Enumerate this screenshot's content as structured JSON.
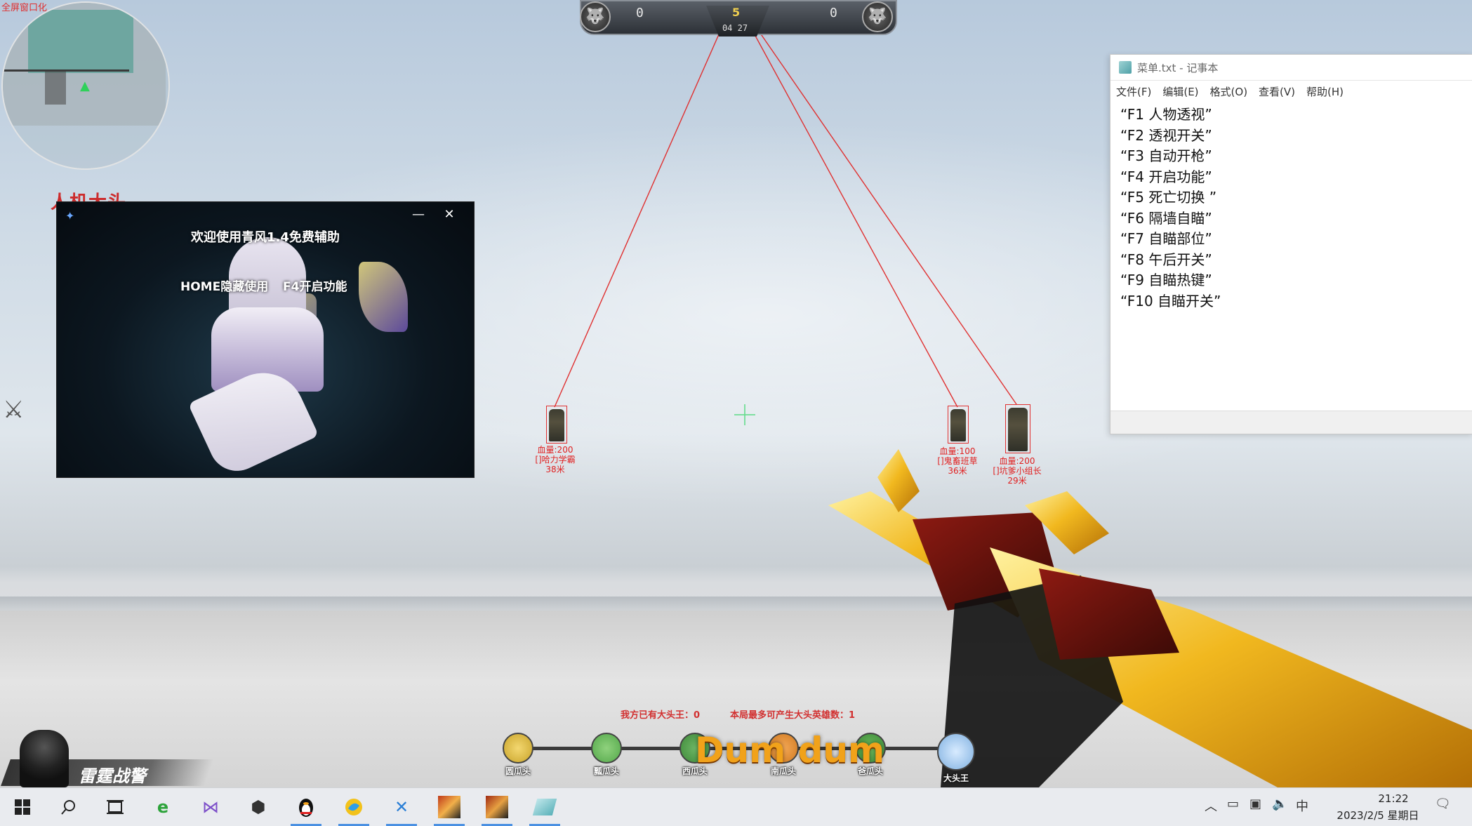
{
  "hud": {
    "map_label": "全屏窗口化",
    "team_label": "人机大头",
    "score_left": "0",
    "score_right": "0",
    "round": "5",
    "timer": "04 27",
    "left_emblem": "wolf-emblem-icon",
    "right_emblem": "wolf-emblem-icon"
  },
  "popup": {
    "title": "欢迎使用青风1.4免费辅助",
    "left_text": "HOME隐藏使用",
    "right_text": "F4开启功能",
    "minimize": "—",
    "close": "✕"
  },
  "enemies": [
    {
      "hp": "血量:200",
      "name": "[]哈力学霸",
      "dist": "38米"
    },
    {
      "hp": "血量:100",
      "name": "[]鬼畜班草",
      "dist": "36米"
    },
    {
      "hp": "血量:200",
      "name": "[]坑爹小组长",
      "dist": "29米"
    }
  ],
  "bottom_hud": {
    "msg_left": "我方已有大头王：",
    "msg_left_count": "0",
    "msg_right": "本局最多可产生大头英雄数：",
    "msg_right_count": "1",
    "brand": "Dum dum",
    "ranks": [
      {
        "label": "圆瓜头",
        "color": "#c9a42a"
      },
      {
        "label": "瓢瓜头",
        "color": "#53a84a"
      },
      {
        "label": "西瓜头",
        "color": "#3f8a3a"
      },
      {
        "label": "南瓜头",
        "color": "#d07a20"
      },
      {
        "label": "爸瓜头",
        "color": "#3d8b3a"
      },
      {
        "label": "大头王",
        "color": "#7fb0e0"
      }
    ]
  },
  "player": {
    "name": "雷霆战警"
  },
  "notepad": {
    "title": "菜单.txt - 记事本",
    "menu": [
      "文件(F)",
      "编辑(E)",
      "格式(O)",
      "查看(V)",
      "帮助(H)"
    ],
    "lines": [
      "“F1 人物透视”",
      "“F2 透视开关”",
      "“F3 自动开枪”",
      "“F4 开启功能”",
      "“F5 死亡切换 ”",
      "“F6 隔墙自瞄”",
      "“F7 自瞄部位”",
      "“F8 午后开关”",
      "“F9 自瞄热键”",
      "“F10 自瞄开关”"
    ]
  },
  "taskbar": {
    "apps": [
      "windows-start-icon",
      "search-icon",
      "task-view-icon",
      "ie-browser-icon",
      "visual-studio-icon",
      "3d-box-icon",
      "qq-penguin-icon",
      "qq-browser-icon",
      "feather-app-icon",
      "game-app-icon",
      "game-app-2-icon",
      "notepad-app-icon"
    ],
    "tray_ime": "中",
    "time": "21:22",
    "date": "2023/2/5 星期日"
  },
  "colors": {
    "esp_red": "#e03030",
    "gold": "#f1a21a"
  }
}
